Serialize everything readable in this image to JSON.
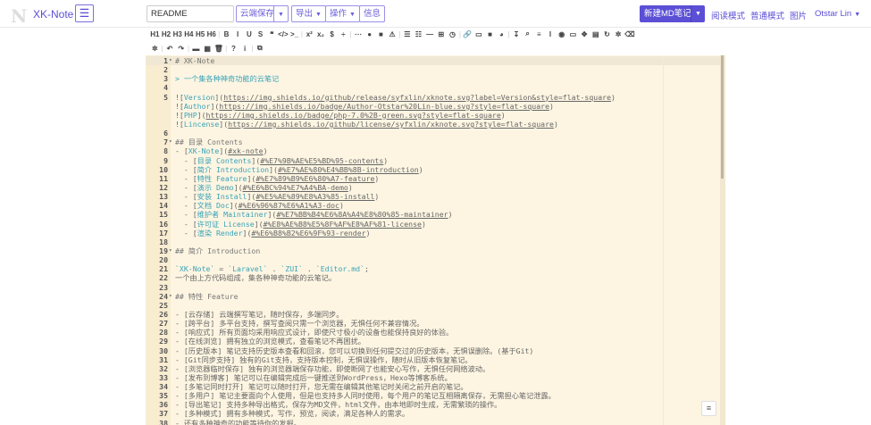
{
  "colors": {
    "accent": "#5b4fd6",
    "editor_bg": "#fdf5e2",
    "link": "#3aa3b8"
  },
  "nav": {
    "logo": "N",
    "brand": "XK-Note",
    "menu_icon": "hamburger-icon",
    "title_value": "README",
    "cloud_save": "云端保存",
    "export": "导出",
    "actions": "操作",
    "info": "信息",
    "new_note": "新建MD笔记",
    "read_mode": "阅读模式",
    "normal_mode": "普通模式",
    "images": "图片",
    "user": "Otstar Lin"
  },
  "toolbar": {
    "row1": [
      "H1",
      "H2",
      "H3",
      "H4",
      "H5",
      "H6",
      "|",
      "B",
      "I",
      "U",
      "S",
      "❝",
      "</>",
      ">_",
      "|",
      "x²",
      "x₂",
      "$",
      "÷",
      "|",
      "⋯",
      "●",
      "■",
      "⚠",
      "|",
      "☰",
      "☷",
      "—",
      "⊞",
      "◷",
      "|",
      "🔗",
      "▭",
      "■",
      "◕",
      "|",
      "↧",
      "⌕",
      "≡",
      "I",
      "◉",
      "▭",
      "✥",
      "▤",
      "↻",
      "✲",
      "⌫"
    ],
    "row1_names": [
      "h1",
      "h2",
      "h3",
      "h4",
      "h5",
      "h6",
      "sep",
      "bold",
      "italic",
      "underline",
      "strikethrough",
      "quote",
      "code",
      "code-block",
      "sep",
      "superscript",
      "subscript",
      "tex",
      "divide",
      "sep",
      "hr",
      "circle",
      "square",
      "warning",
      "sep",
      "list-ul",
      "list-ol",
      "line",
      "table",
      "datetime",
      "sep",
      "link",
      "image",
      "video",
      "emoji",
      "sep",
      "pagebreak",
      "search",
      "align-justify",
      "cursor",
      "preview",
      "fullscreen",
      "arrows",
      "file",
      "refresh",
      "settings",
      "eraser"
    ],
    "row2": [
      "✲",
      "|",
      "↶",
      "↷",
      "|",
      "▬",
      "▦",
      "🗑",
      "|",
      "?",
      "i",
      "|",
      "⧉"
    ],
    "row2_names": [
      "gear",
      "sep",
      "undo",
      "redo",
      "sep",
      "save",
      "archive",
      "trash",
      "sep",
      "help",
      "info",
      "sep",
      "copy"
    ]
  },
  "editor": {
    "lines": [
      {
        "n": "1",
        "f": true,
        "s": [
          [
            "# XK-Note",
            "h"
          ]
        ]
      },
      {
        "n": "2",
        "s": []
      },
      {
        "n": "3",
        "s": [
          [
            "> 一个集各种神奇功能的云笔记",
            "q"
          ]
        ]
      },
      {
        "n": "4",
        "s": []
      },
      {
        "n": "5",
        "s": [
          [
            "![",
            "p"
          ],
          [
            "Version",
            "lk"
          ],
          [
            "](",
            "p"
          ],
          [
            "https://img.shields.io/github/release/syfxlin/xknote.svg?label=Version&style=flat-square",
            "u"
          ],
          [
            ")",
            "p"
          ]
        ]
      },
      {
        "n": "",
        "s": [
          [
            "![",
            "p"
          ],
          [
            "Author",
            "lk"
          ],
          [
            "](",
            "p"
          ],
          [
            "https://img.shields.io/badge/Author-Otstar%20Lin-blue.svg?style=flat-square",
            "u"
          ],
          [
            ")",
            "p"
          ]
        ]
      },
      {
        "n": "",
        "s": [
          [
            "![",
            "p"
          ],
          [
            "PHP",
            "lk"
          ],
          [
            "](",
            "p"
          ],
          [
            "https://img.shields.io/badge/php-7.0%2B-green.svg?style=flat-square",
            "u"
          ],
          [
            ")",
            "p"
          ]
        ]
      },
      {
        "n": "",
        "s": [
          [
            "![",
            "p"
          ],
          [
            "Lincense",
            "lk"
          ],
          [
            "](",
            "p"
          ],
          [
            "https://img.shields.io/github/license/syfxlin/xknote.svg?style=flat-square",
            "u"
          ],
          [
            ")",
            "p"
          ]
        ]
      },
      {
        "n": "6",
        "s": []
      },
      {
        "n": "7",
        "f": true,
        "s": [
          [
            "## 目录 Contents",
            "h"
          ]
        ]
      },
      {
        "n": "8",
        "s": [
          [
            "- [",
            "p"
          ],
          [
            "XK-Note",
            "lk"
          ],
          [
            "](",
            "p"
          ],
          [
            "#xk-note",
            "u"
          ],
          [
            ")",
            "p"
          ]
        ]
      },
      {
        "n": "9",
        "s": [
          [
            "  - [",
            "p"
          ],
          [
            "目录 Contents",
            "lk"
          ],
          [
            "](",
            "p"
          ],
          [
            "#%E7%9B%AE%E5%BD%95-contents",
            "u"
          ],
          [
            ")",
            "p"
          ]
        ]
      },
      {
        "n": "10",
        "s": [
          [
            "  - [",
            "p"
          ],
          [
            "简介 Introduction",
            "lk"
          ],
          [
            "](",
            "p"
          ],
          [
            "#%E7%AE%80%E4%BB%8B-introduction",
            "u"
          ],
          [
            ")",
            "p"
          ]
        ]
      },
      {
        "n": "11",
        "s": [
          [
            "  - [",
            "p"
          ],
          [
            "特性 Feature",
            "lk"
          ],
          [
            "](",
            "p"
          ],
          [
            "#%E7%89%B9%E6%80%A7-feature",
            "u"
          ],
          [
            ")",
            "p"
          ]
        ]
      },
      {
        "n": "12",
        "s": [
          [
            "  - [",
            "p"
          ],
          [
            "演示 Demo",
            "lk"
          ],
          [
            "](",
            "p"
          ],
          [
            "#%E6%BC%94%E7%A4%BA-demo",
            "u"
          ],
          [
            ")",
            "p"
          ]
        ]
      },
      {
        "n": "13",
        "s": [
          [
            "  - [",
            "p"
          ],
          [
            "安装 Install",
            "lk"
          ],
          [
            "](",
            "p"
          ],
          [
            "#%E5%AE%89%E8%A3%85-install",
            "u"
          ],
          [
            ")",
            "p"
          ]
        ]
      },
      {
        "n": "14",
        "s": [
          [
            "  - [",
            "p"
          ],
          [
            "文档 Doc",
            "lk"
          ],
          [
            "](",
            "p"
          ],
          [
            "#%E6%96%87%E6%A1%A3-doc",
            "u"
          ],
          [
            ")",
            "p"
          ]
        ]
      },
      {
        "n": "15",
        "s": [
          [
            "  - [",
            "p"
          ],
          [
            "维护者 Maintainer",
            "lk"
          ],
          [
            "](",
            "p"
          ],
          [
            "#%E7%BB%B4%E6%8A%A4%E8%80%85-maintainer",
            "u"
          ],
          [
            ")",
            "p"
          ]
        ]
      },
      {
        "n": "16",
        "s": [
          [
            "  - [",
            "p"
          ],
          [
            "许可证 License",
            "lk"
          ],
          [
            "](",
            "p"
          ],
          [
            "#%E8%AE%B8%E5%8F%AF%E8%AF%81-license",
            "u"
          ],
          [
            ")",
            "p"
          ]
        ]
      },
      {
        "n": "17",
        "s": [
          [
            "  - [",
            "p"
          ],
          [
            "渲染 Render",
            "lk"
          ],
          [
            "](",
            "p"
          ],
          [
            "#%E6%B8%B2%E6%9F%93-render",
            "u"
          ],
          [
            ")",
            "p"
          ]
        ]
      },
      {
        "n": "18",
        "s": []
      },
      {
        "n": "19",
        "f": true,
        "s": [
          [
            "## 简介 Introduction",
            "h"
          ]
        ]
      },
      {
        "n": "20",
        "s": []
      },
      {
        "n": "21",
        "s": [
          [
            "`XK-Note`",
            "c"
          ],
          [
            " = ",
            "p"
          ],
          [
            "`Laravel`",
            "c"
          ],
          [
            " . ",
            "p"
          ],
          [
            "`ZUI`",
            "c"
          ],
          [
            " . ",
            "p"
          ],
          [
            "`Editor.md`",
            "c"
          ],
          [
            ";",
            "p"
          ]
        ]
      },
      {
        "n": "22",
        "s": [
          [
            "一个由上方代码组成，集各种神奇功能的云笔记。",
            "p"
          ]
        ]
      },
      {
        "n": "23",
        "s": []
      },
      {
        "n": "24",
        "f": true,
        "s": [
          [
            "## 特性 Feature",
            "h"
          ]
        ]
      },
      {
        "n": "25",
        "s": []
      },
      {
        "n": "26",
        "s": [
          [
            "- [云存储] 云端撰写笔记，随时保存，多端同步。",
            "p"
          ]
        ]
      },
      {
        "n": "27",
        "s": [
          [
            "- [跨平台] 多平台支持，撰写查阅只需一个浏览器，无惧任何不兼容情况。",
            "p"
          ]
        ]
      },
      {
        "n": "28",
        "s": [
          [
            "- [响应式] 所有页面均采用响应式设计，即使尺寸极小的设备也能保持良好的体验。",
            "p"
          ]
        ]
      },
      {
        "n": "29",
        "s": [
          [
            "- [在线浏览] 拥有独立的浏览模式，查看笔记不再困扰。",
            "p"
          ]
        ]
      },
      {
        "n": "30",
        "s": [
          [
            "- [历史版本] 笔记支持历史版本查看和回滚，您可以切换到任何提交过的历史版本，无惧误删除。(基于Git)",
            "p"
          ]
        ]
      },
      {
        "n": "31",
        "s": [
          [
            "- [Git同步支持] 独有的Git支持，支持版本控制，无惧误操作，随时从旧版本恢复笔记。",
            "p"
          ]
        ]
      },
      {
        "n": "32",
        "s": [
          [
            "- [浏览器临时保存] 独有的浏览器端保存功能，即使断网了也能安心写作，无惧任何网络波动。",
            "p"
          ]
        ]
      },
      {
        "n": "33",
        "s": [
          [
            "- [发布到博客] 笔记可以在编辑完成后一键推送到WordPress，Hexo等博客系统。",
            "p"
          ]
        ]
      },
      {
        "n": "34",
        "s": [
          [
            "- [多笔记同时打开] 笔记可以随时打开，您无需在编辑其他笔记时关闭之前开启的笔记。",
            "p"
          ]
        ]
      },
      {
        "n": "35",
        "s": [
          [
            "- [多用户] 笔记主要面向个人使用，但是也支持多人同时使用，每个用户的笔记互相隔离保存，无需担心笔记泄露。",
            "p"
          ]
        ]
      },
      {
        "n": "36",
        "s": [
          [
            "- [导出笔记] 支持多种导出格式，保存为MD文件，html文件，由本地即时生成，无需繁琐的操作。",
            "p"
          ]
        ]
      },
      {
        "n": "37",
        "s": [
          [
            "- [多种模式] 拥有多种模式，写作，预览，阅读，满足各种人的需求。",
            "p"
          ]
        ]
      },
      {
        "n": "38",
        "s": [
          [
            "- 还有多种神奇的功能等待你的发掘。",
            "p"
          ]
        ]
      }
    ],
    "toc_button": "≡"
  }
}
